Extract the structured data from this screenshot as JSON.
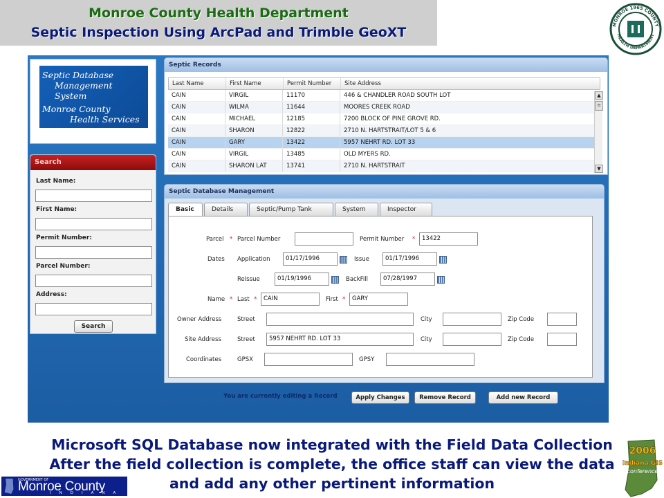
{
  "header": {
    "line1": "Monroe County Health Department",
    "line2": "Septic Inspection Using ArcPad and Trimble GeoXT"
  },
  "seal": {
    "text_top": "MONROE 1965 COUNTY",
    "text_bottom": "HEALTH DEPARTMENT"
  },
  "app": {
    "logo": {
      "line1": "Septic Database",
      "line2": "Management System",
      "line3": "Monroe County",
      "line4": "Health Services"
    },
    "search": {
      "title": "Search",
      "last_name_label": "Last Name:",
      "first_name_label": "First Name:",
      "permit_label": "Permit Number:",
      "parcel_label": "Parcel Number:",
      "address_label": "Address:",
      "button": "Search"
    },
    "records": {
      "title": "Septic Records",
      "columns": [
        "Last Name",
        "First Name",
        "Permit Number",
        "Site Address"
      ],
      "rows": [
        [
          "CAIN",
          "VIRGIL",
          "11170",
          "446 & CHANDLER ROAD SOUTH LOT"
        ],
        [
          "CAIN",
          "WILMA",
          "11644",
          "MOORES CREEK ROAD"
        ],
        [
          "CAIN",
          "MICHAEL",
          "12185",
          "7200 BLOCK OF PINE GROVE RD."
        ],
        [
          "CAIN",
          "SHARON",
          "12822",
          "2710 N. HARTSTRAIT/LOT 5 & 6"
        ],
        [
          "CAIN",
          "GARY",
          "13422",
          "5957 NEHRT RD.  LOT  33"
        ],
        [
          "CAIN",
          "VIRGIL",
          "13485",
          "OLD MYERS RD."
        ],
        [
          "CAIN",
          "SHARON LAT",
          "13741",
          "2710 N. HARTSTRAIT"
        ]
      ],
      "selected_row_index": 4
    },
    "management": {
      "title": "Septic Database Management",
      "tabs": [
        "Basic",
        "Details",
        "Septic/Pump Tank",
        "System",
        "Inspector"
      ],
      "active_tab": "Basic",
      "labels": {
        "parcel": "Parcel",
        "parcel_number": "Parcel Number",
        "permit_number": "Permit Number",
        "dates": "Dates",
        "application": "Application",
        "issue": "Issue",
        "reissue": "ReIssue",
        "backfill": "BackFill",
        "name": "Name",
        "last": "Last",
        "first": "First",
        "owner_address": "Owner Address",
        "street": "Street",
        "city": "City",
        "zip": "Zip Code",
        "site_address": "Site Address",
        "coordinates": "Coordinates",
        "gpsx": "GPSX",
        "gpsy": "GPSY",
        "required": "*"
      },
      "values": {
        "parcel_number": "",
        "permit_number": "13422",
        "application": "01/17/1996",
        "issue": "01/17/1996",
        "reissue": "01/19/1996",
        "backfill": "07/28/1997",
        "last": "CAIN",
        "first": "GARY",
        "owner_street": "",
        "owner_city": "",
        "owner_zip": "",
        "site_street": "5957 NEHRT RD.  LOT  33",
        "site_city": "",
        "site_zip": "",
        "gpsx": "",
        "gpsy": ""
      }
    },
    "footer": {
      "status": "You are currently editing a Record",
      "apply": "Apply Changes",
      "remove": "Remove Record",
      "add": "Add new Record"
    }
  },
  "caption": {
    "line1": "Microsoft SQL Database now integrated with the Field Data Collection",
    "line2": "After the field collection is complete, the office staff can view the data",
    "line3": "and add any other pertinent information"
  },
  "bottom_logo": {
    "small": "GOVERNMENT OF",
    "name": "Monroe County",
    "state": "INDIANA"
  },
  "gis_badge": {
    "year": "2006",
    "line1": "Indiana GIS",
    "line2": "conference"
  },
  "colors": {
    "title_green": "#1b6b12",
    "title_blue": "#0a1a7a",
    "frame_blue": "#1f6fbf",
    "selected_row": "#b8d3f0",
    "required_red": "#d01e1e"
  }
}
